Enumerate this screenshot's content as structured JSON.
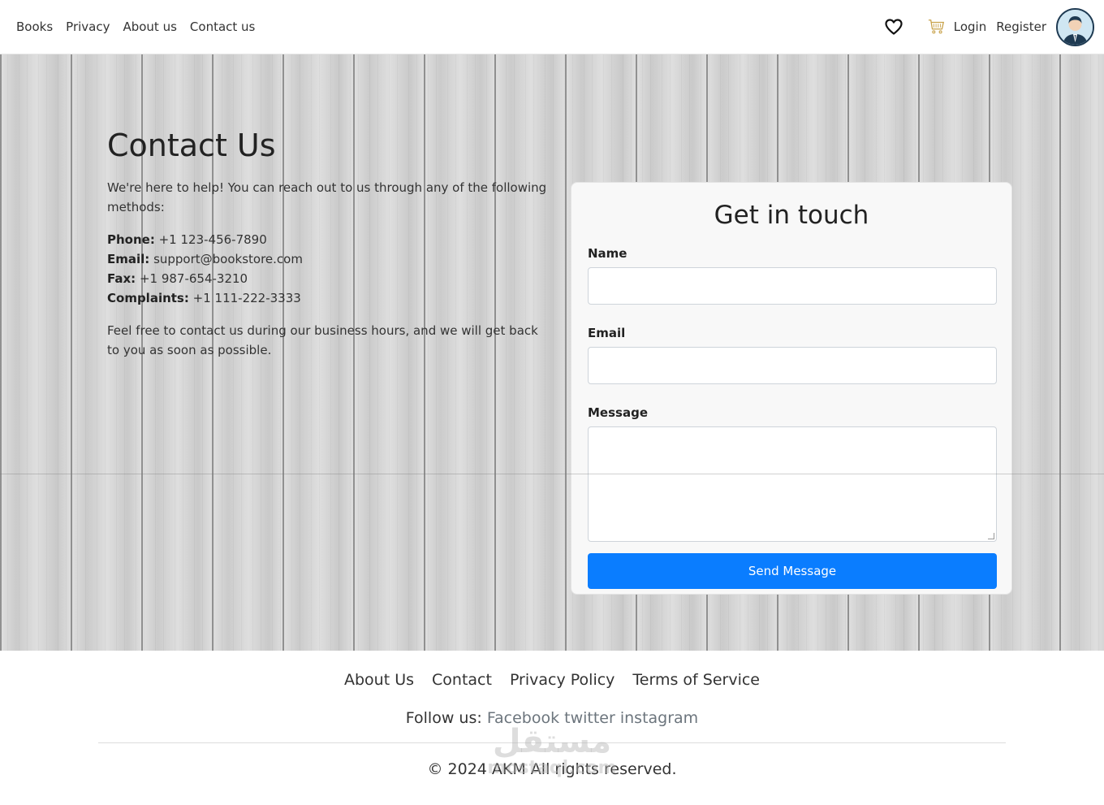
{
  "nav": {
    "links": [
      "Books",
      "Privacy",
      "About us",
      "Contact us"
    ],
    "login": "Login",
    "register": "Register"
  },
  "contact": {
    "title": "Contact Us",
    "intro": "We're here to help! You can reach out to us through any of the following methods:",
    "phone_label": "Phone:",
    "phone": "+1 123-456-7890",
    "email_label": "Email:",
    "email": "support@bookstore.com",
    "fax_label": "Fax:",
    "fax": "+1 987-654-3210",
    "complaints_label": "Complaints:",
    "complaints": "+1 111-222-3333",
    "outro": "Feel free to contact us during our business hours, and we will get back to you as soon as possible."
  },
  "form": {
    "title": "Get in touch",
    "name_label": "Name",
    "email_label": "Email",
    "message_label": "Message",
    "submit": "Send Message"
  },
  "footer": {
    "links": [
      "About Us",
      "Contact",
      "Privacy Policy",
      "Terms of Service"
    ],
    "follow_label": "Follow us:",
    "social": [
      "Facebook",
      "twitter",
      "instagram"
    ],
    "copyright": "© 2024 AKM All rights reserved.",
    "watermark_ar": "مستقل",
    "watermark_lat": "mostaql.com"
  },
  "colors": {
    "primary": "#0a7dff",
    "avatar_border": "#1e3a52"
  },
  "icons": {
    "wishlist": "heart-icon",
    "cart": "cart-icon",
    "profile": "avatar"
  }
}
